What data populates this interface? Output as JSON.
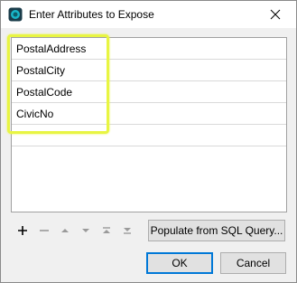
{
  "dialog": {
    "title": "Enter Attributes to Expose",
    "icons": {
      "app": "fme-app-icon",
      "close": "close-icon"
    }
  },
  "attributes": {
    "items": [
      "PostalAddress",
      "PostalCity",
      "PostalCode",
      "CivicNo",
      ""
    ]
  },
  "toolbar": {
    "icons": [
      "add-icon",
      "remove-icon",
      "move-up-icon",
      "move-down-icon",
      "move-top-icon",
      "move-bottom-icon"
    ],
    "populate_label": "Populate from SQL Query..."
  },
  "buttons": {
    "ok_label": "OK",
    "cancel_label": "Cancel"
  },
  "colors": {
    "highlight": "#e8f542",
    "accent": "#0078d7"
  }
}
